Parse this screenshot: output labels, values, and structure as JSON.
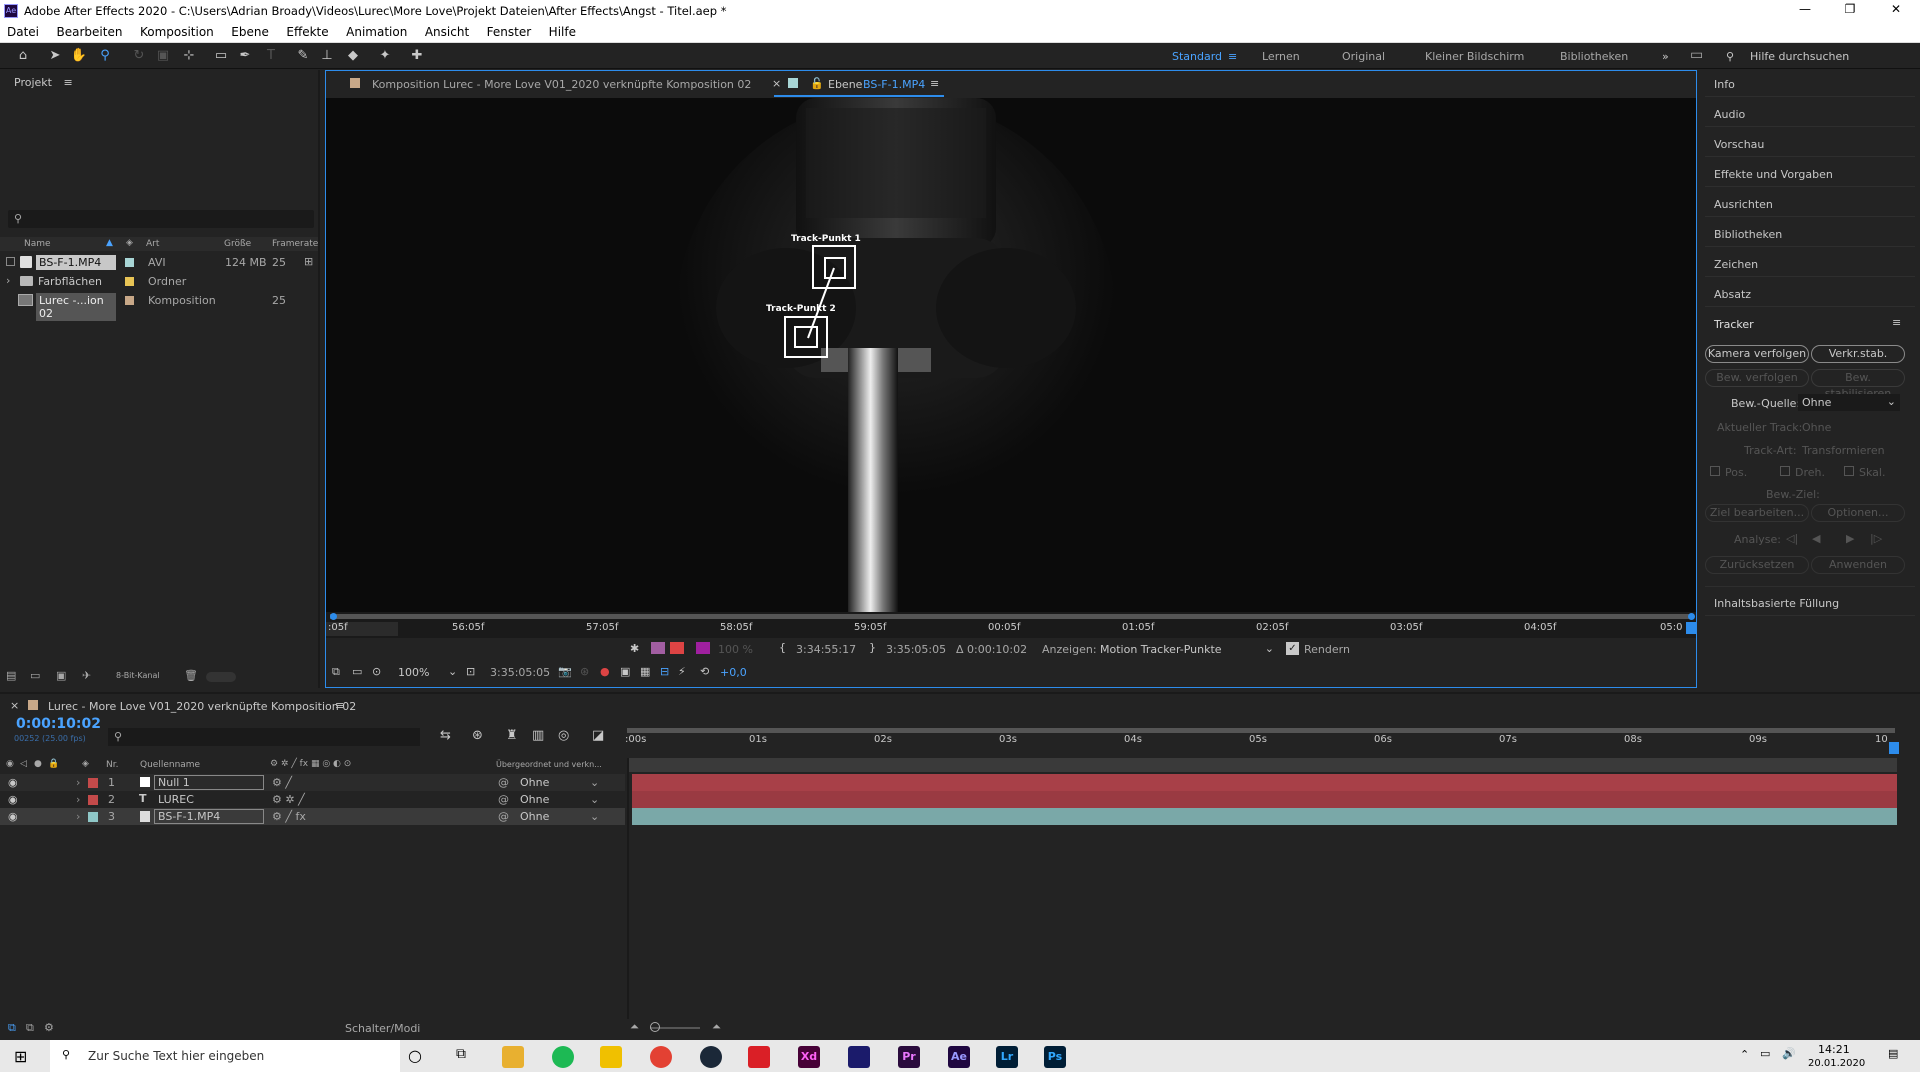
{
  "window": {
    "app_icon": "Ae",
    "title": "Adobe After Effects 2020 - C:\\Users\\Adrian Broady\\Videos\\Lurec\\More Love\\Projekt Dateien\\After Effects\\Angst - Titel.aep *"
  },
  "menu": [
    "Datei",
    "Bearbeiten",
    "Komposition",
    "Ebene",
    "Effekte",
    "Animation",
    "Ansicht",
    "Fenster",
    "Hilfe"
  ],
  "workspaces": {
    "items": [
      "Standard",
      "Lernen",
      "Original",
      "Kleiner Bildschirm",
      "Bibliotheken"
    ],
    "active": "Standard",
    "more": "»",
    "search_placeholder": "Hilfe durchsuchen"
  },
  "project": {
    "title": "Projekt",
    "search_placeholder": "",
    "columns": [
      "Name",
      "Art",
      "Größe",
      "Framerate"
    ],
    "items": [
      {
        "name": "BS-F-1.MP4",
        "type": "AVI",
        "size": "124 MB",
        "fps": "25",
        "color": "#a8d5d5"
      },
      {
        "name": "Farbflächen",
        "type": "Ordner",
        "size": "",
        "fps": "",
        "color": "#e8c455"
      },
      {
        "name": "Lurec -...ion 02",
        "type": "Komposition",
        "size": "",
        "fps": "25",
        "color": "#c8a888"
      }
    ],
    "bit_depth": "8-Bit-Kanal"
  },
  "viewer": {
    "tab1": "Komposition  Lurec - More Love V01_2020 verknüpfte Komposition 02",
    "tab2_prefix": "Ebene",
    "tab2_layer": "BS-F-1.MP4",
    "track_point_1": "Track-Punkt 1",
    "track_point_2": "Track-Punkt 2",
    "ruler_labels": [
      ":05f",
      "56:05f",
      "57:05f",
      "58:05f",
      "59:05f",
      "00:05f",
      "01:05f",
      "02:05f",
      "03:05f",
      "04:05f",
      "05:0"
    ],
    "in_time": "3:34:55:17",
    "out_time": "3:35:05:05",
    "duration": "Δ 0:00:10:02",
    "show_label": "Anzeigen:",
    "show_value": "Motion Tracker-Punkte",
    "render_label": "Rendern",
    "opacity": "100 %",
    "zoom": "100%",
    "current_time": "3:35:05:05",
    "exposure": "+0,0"
  },
  "right_panels": {
    "items": [
      "Info",
      "Audio",
      "Vorschau",
      "Effekte und Vorgaben",
      "Ausrichten",
      "Bibliotheken",
      "Zeichen",
      "Absatz"
    ],
    "tracker": {
      "title": "Tracker",
      "btn_camera": "Kamera verfolgen",
      "btn_stab": "Verkr.stab.",
      "btn_track_motion": "Bew. verfolgen",
      "btn_stabilize": "Bew. stabilisieren",
      "source_label": "Bew.-Quelle:",
      "source_value": "Ohne",
      "current_track_label": "Aktueller Track:",
      "current_track_value": "Ohne",
      "track_type_label": "Track-Art:",
      "track_type_value": "Transformieren",
      "pos": "Pos.",
      "rot": "Dreh.",
      "scale": "Skal.",
      "target_label": "Bew.-Ziel:",
      "edit_target": "Ziel bearbeiten...",
      "options": "Optionen...",
      "analyze": "Analyse:",
      "reset": "Zurücksetzen",
      "apply": "Anwenden"
    },
    "content_fill": "Inhaltsbasierte Füllung"
  },
  "timeline": {
    "comp_name": "Lurec - More Love V01_2020 verknüpfte Komposition 02",
    "timecode": "0:00:10:02",
    "frames": "00252 (25.00 fps)",
    "col_nr": "Nr.",
    "col_source": "Quellenname",
    "col_parent": "Übergeordnet und verkn...",
    "ruler": [
      ":00s",
      "01s",
      "02s",
      "03s",
      "04s",
      "05s",
      "06s",
      "07s",
      "08s",
      "09s",
      "10"
    ],
    "layers": [
      {
        "nr": "1",
        "name": "Null 1",
        "type": "null",
        "parent": "Ohne",
        "color": "#c44a4a"
      },
      {
        "nr": "2",
        "name": "LUREC",
        "type": "text",
        "parent": "Ohne",
        "color": "#c44a4a"
      },
      {
        "nr": "3",
        "name": "BS-F-1.MP4",
        "type": "footage",
        "parent": "Ohne",
        "color": "#8fc7c7"
      }
    ],
    "footer": "Schalter/Modi"
  },
  "taskbar": {
    "search": "Zur Suche Text hier eingeben",
    "apps": [
      {
        "label": "Xd",
        "color": "#470137"
      },
      {
        "label": "Pr",
        "color": "#2a0b3d"
      },
      {
        "label": "Ae",
        "color": "#1f0740"
      },
      {
        "label": "Lr",
        "color": "#001e36"
      },
      {
        "label": "Ps",
        "color": "#001e36"
      }
    ],
    "time": "14:21",
    "date": "20.01.2020"
  }
}
